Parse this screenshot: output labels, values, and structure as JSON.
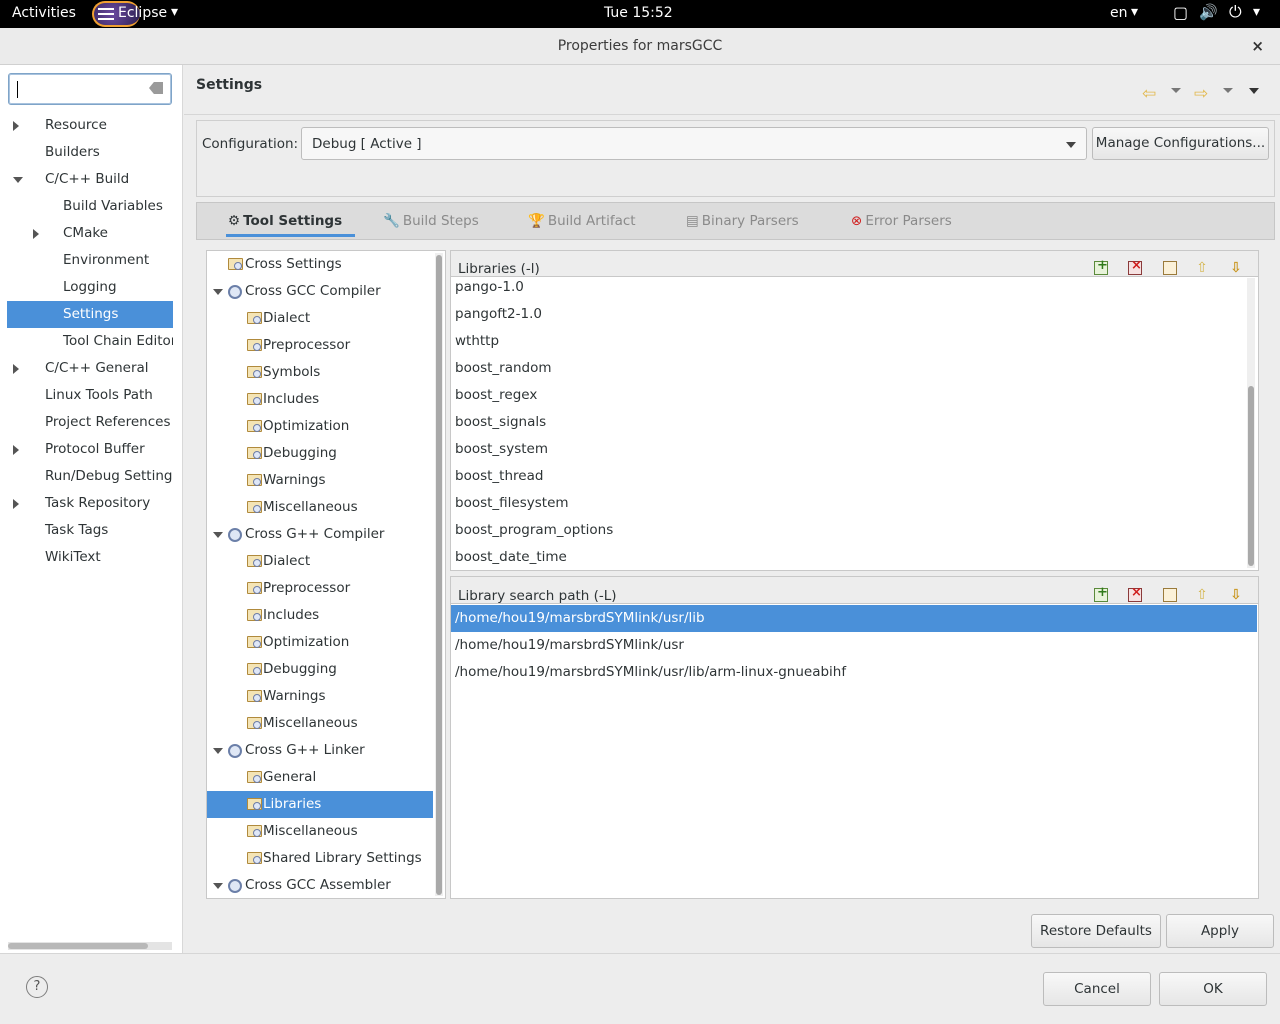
{
  "topbar": {
    "activities": "Activities",
    "app": "Eclipse",
    "clock": "Tue 15:52",
    "lang": "en"
  },
  "window": {
    "title": "Properties for marsGCC",
    "close": "×"
  },
  "nav": {
    "filter_value": "",
    "items": [
      {
        "label": "Resource"
      },
      {
        "label": "Builders"
      },
      {
        "label": "C/C++ Build"
      },
      {
        "label": "Build Variables"
      },
      {
        "label": "CMake"
      },
      {
        "label": "Environment"
      },
      {
        "label": "Logging"
      },
      {
        "label": "Settings"
      },
      {
        "label": "Tool Chain Editor"
      },
      {
        "label": "C/C++ General"
      },
      {
        "label": "Linux Tools Path"
      },
      {
        "label": "Project References"
      },
      {
        "label": "Protocol Buffer"
      },
      {
        "label": "Run/Debug Settings"
      },
      {
        "label": "Task Repository"
      },
      {
        "label": "Task Tags"
      },
      {
        "label": "WikiText"
      }
    ],
    "selected": "Settings"
  },
  "page": {
    "heading": "Settings"
  },
  "config": {
    "label": "Configuration:",
    "value": "Debug  [ Active ]",
    "manage_button": "Manage Configurations..."
  },
  "tabs": [
    {
      "label": "Tool Settings",
      "active": true
    },
    {
      "label": "Build Steps",
      "active": false
    },
    {
      "label": "Build Artifact",
      "active": false
    },
    {
      "label": "Binary Parsers",
      "active": false
    },
    {
      "label": "Error Parsers",
      "active": false
    }
  ],
  "tools": [
    {
      "label": "Cross Settings"
    },
    {
      "label": "Cross GCC Compiler"
    },
    {
      "label": "Dialect"
    },
    {
      "label": "Preprocessor"
    },
    {
      "label": "Symbols"
    },
    {
      "label": "Includes"
    },
    {
      "label": "Optimization"
    },
    {
      "label": "Debugging"
    },
    {
      "label": "Warnings"
    },
    {
      "label": "Miscellaneous"
    },
    {
      "label": "Cross G++ Compiler"
    },
    {
      "label": "Dialect"
    },
    {
      "label": "Preprocessor"
    },
    {
      "label": "Includes"
    },
    {
      "label": "Optimization"
    },
    {
      "label": "Debugging"
    },
    {
      "label": "Warnings"
    },
    {
      "label": "Miscellaneous"
    },
    {
      "label": "Cross G++ Linker"
    },
    {
      "label": "General"
    },
    {
      "label": "Libraries"
    },
    {
      "label": "Miscellaneous"
    },
    {
      "label": "Shared Library Settings"
    },
    {
      "label": "Cross GCC Assembler"
    }
  ],
  "libraries": {
    "title": "Libraries (-l)",
    "items": [
      "pango-1.0",
      "pangoft2-1.0",
      "wthttp",
      "boost_random",
      "boost_regex",
      "boost_signals",
      "boost_system",
      "boost_thread",
      "boost_filesystem",
      "boost_program_options",
      "boost_date_time"
    ]
  },
  "search_paths": {
    "title": "Library search path (-L)",
    "items": [
      "/home/hou19/marsbrdSYMlink/usr/lib",
      "/home/hou19/marsbrdSYMlink/usr",
      "/home/hou19/marsbrdSYMlink/usr/lib/arm-linux-gnueabihf"
    ]
  },
  "buttons": {
    "restore": "Restore Defaults",
    "apply": "Apply",
    "cancel": "Cancel",
    "ok": "OK",
    "help": "?"
  }
}
